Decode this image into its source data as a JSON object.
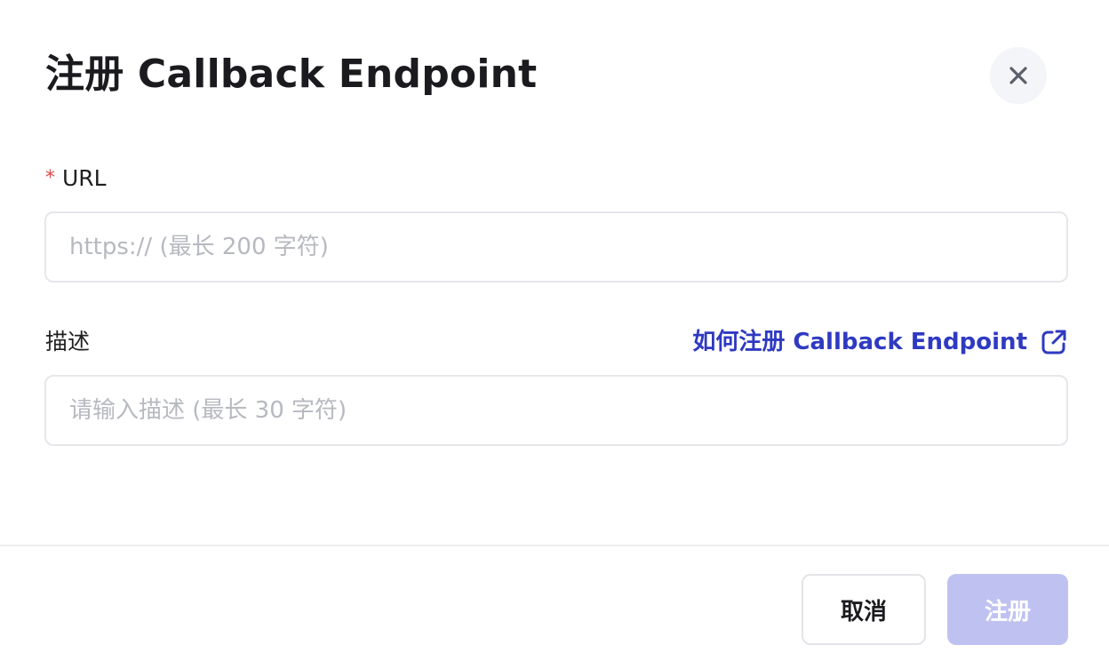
{
  "dialog": {
    "title": "注册 Callback Endpoint",
    "close_icon": "close-icon"
  },
  "form": {
    "url": {
      "required_mark": "*",
      "label": "URL",
      "value": "",
      "placeholder": "https:// (最长 200 字符)"
    },
    "description": {
      "label": "描述",
      "value": "",
      "placeholder": "请输入描述 (最长 30 字符)"
    },
    "help_link": {
      "label": "如何注册 Callback Endpoint",
      "icon": "external-link-icon"
    }
  },
  "footer": {
    "cancel_label": "取消",
    "submit_label": "注册"
  },
  "colors": {
    "link": "#2f3ac2",
    "required": "#e04848",
    "submit_disabled_bg": "#bfc2f1",
    "close_bg": "#f4f5f8"
  }
}
